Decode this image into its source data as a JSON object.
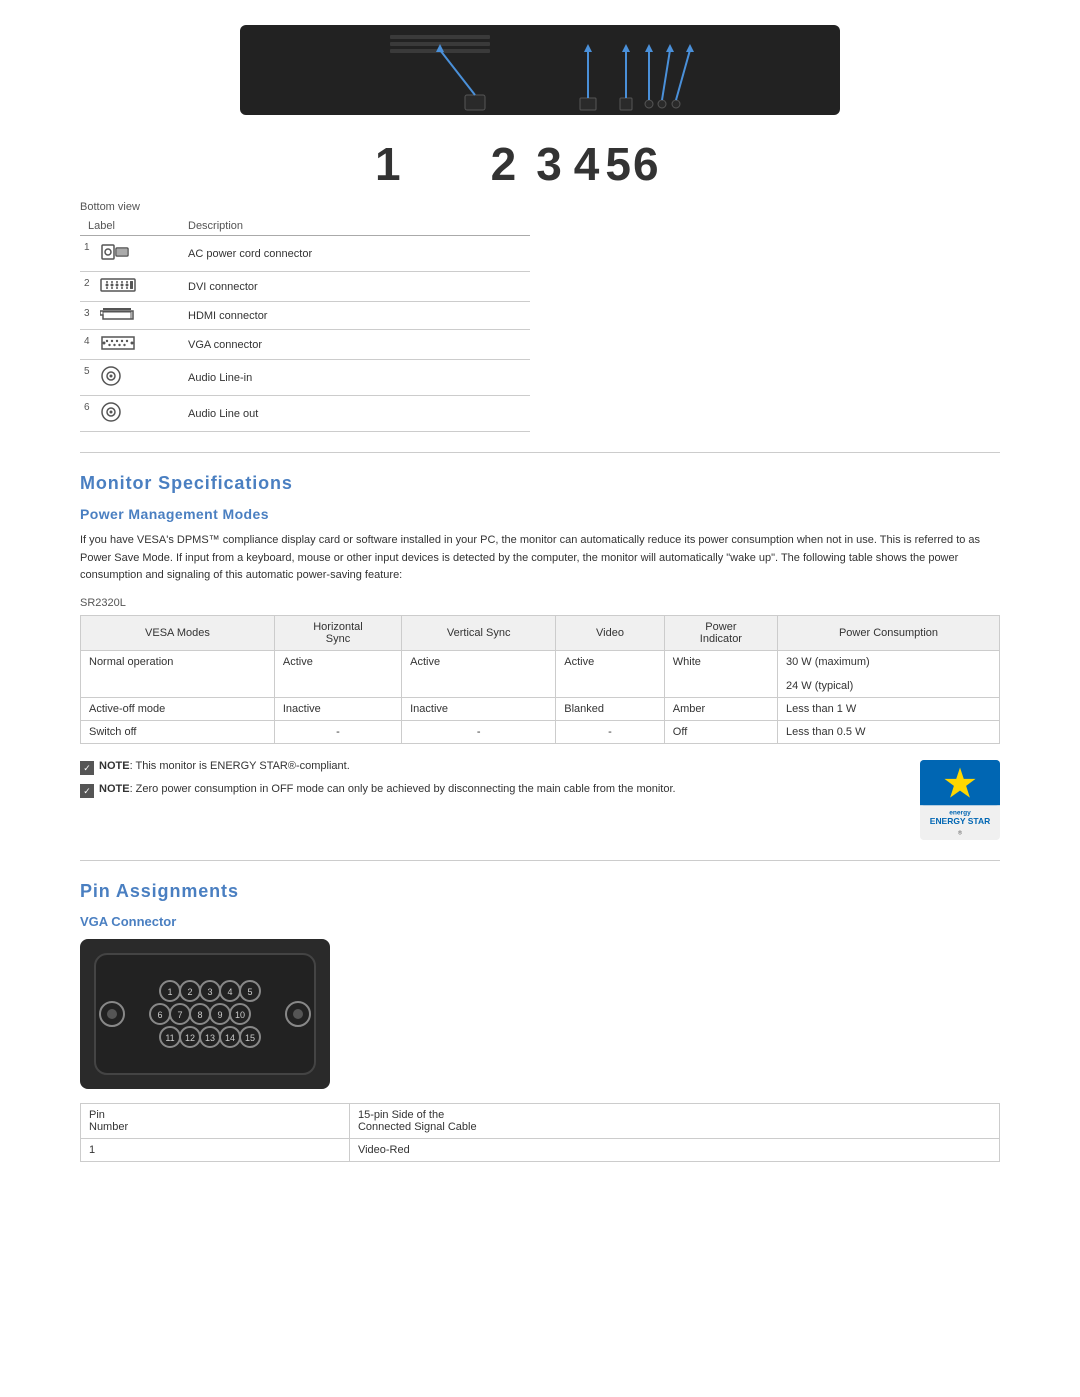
{
  "monitor_image": {
    "alt": "Monitor bottom view with labeled connectors"
  },
  "number_labels": [
    "1",
    "2",
    "3",
    "4",
    "5",
    "6"
  ],
  "bottom_view": {
    "label": "Bottom view",
    "table_headers": [
      "Label",
      "Description"
    ],
    "rows": [
      {
        "num": "1",
        "icon": "power",
        "description": "AC power cord connector"
      },
      {
        "num": "2",
        "icon": "dvi",
        "description": "DVI connector"
      },
      {
        "num": "3",
        "icon": "hdmi",
        "description": "HDMI connector"
      },
      {
        "num": "4",
        "icon": "vga",
        "description": "VGA connector"
      },
      {
        "num": "5",
        "icon": "audio",
        "description": "Audio Line-in"
      },
      {
        "num": "6",
        "icon": "audio",
        "description": "Audio Line out"
      }
    ]
  },
  "monitor_specs": {
    "section_title": "Monitor Specifications",
    "power_mgmt": {
      "title": "Power Management Modes",
      "description": "If you have VESA's DPMS™ compliance display card or software installed in your PC, the monitor can automatically reduce its power consumption when not in use. This is referred to as Power Save Mode. If input from a keyboard, mouse or other input devices is detected by the computer, the monitor will automatically \"wake up\". The following table shows the power consumption and signaling of this automatic power-saving feature:",
      "model": "SR2320L",
      "table_headers": [
        "VESA Modes",
        "Horizontal\nSync",
        "Vertical Sync",
        "Video",
        "Power\nIndicator",
        "Power Consumption"
      ],
      "rows": [
        [
          "Normal operation",
          "Active",
          "Active",
          "Active",
          "White",
          "30 W (maximum)\n\n24 W (typical)"
        ],
        [
          "Active-off mode",
          "Inactive",
          "Inactive",
          "Blanked",
          "Amber",
          "Less than 1 W"
        ],
        [
          "Switch off",
          "-",
          "-",
          "-",
          "Off",
          "Less than 0.5 W"
        ]
      ]
    },
    "notes": [
      "NOTE: This monitor is ENERGY STAR®-compliant.",
      "NOTE: Zero power consumption in OFF mode can only be achieved by disconnecting the main cable from the monitor."
    ]
  },
  "pin_assignments": {
    "section_title": "Pin Assignments",
    "vga_connector": {
      "title": "VGA Connector",
      "pin_rows": [
        [
          "1",
          "2",
          "3",
          "4",
          "5"
        ],
        [
          "6",
          "7",
          "8",
          "9",
          "10"
        ],
        [
          "11",
          "12",
          "13",
          "14",
          "15"
        ]
      ],
      "table_headers": [
        "Pin\nNumber",
        "15-pin Side of the\nConnected Signal Cable"
      ],
      "rows": [
        [
          "1",
          "Video-Red"
        ]
      ]
    }
  }
}
